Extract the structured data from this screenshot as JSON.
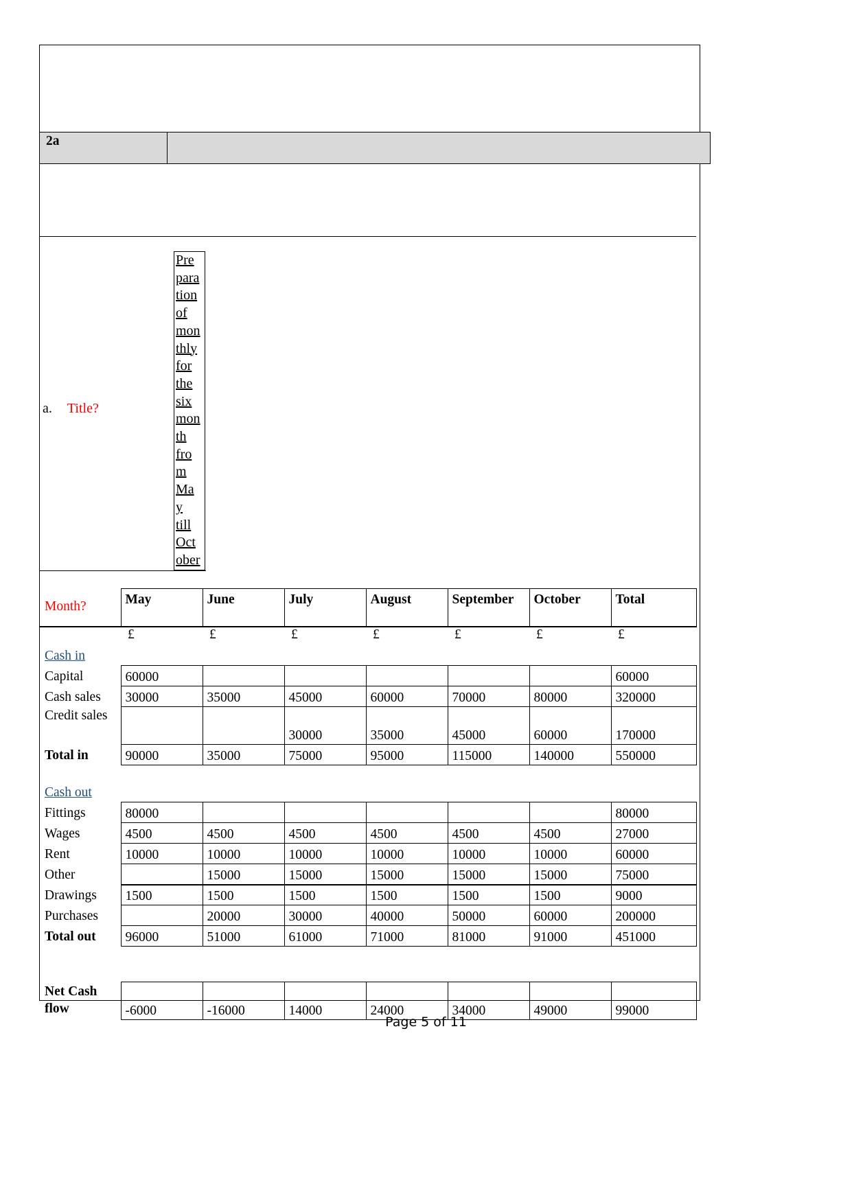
{
  "document": {
    "section_label": "2a",
    "section_label_right": "",
    "question": {
      "marker": "a.",
      "text": "Title?"
    },
    "narrow_column_fragments": [
      "Pre",
      "para",
      "tion",
      "of",
      "mon",
      "thly",
      "for",
      "the",
      "six",
      "mon",
      "th",
      "fro",
      "m",
      "Ma",
      "y",
      "till",
      "Oct",
      "ober"
    ],
    "narrow_column_full_text": "Preparation of monthly for the six month from May till October"
  },
  "table": {
    "row_label_header": "Month?",
    "columns": [
      "May",
      "June",
      "July",
      "August",
      "September",
      "October",
      "Total"
    ],
    "currency_symbol": "£",
    "sections": [
      {
        "heading": "Cash in",
        "rows": [
          {
            "label": "Capital",
            "values": [
              "60000",
              "",
              "",
              "",
              "",
              "",
              "60000"
            ],
            "bold": false,
            "tall": false
          },
          {
            "label": "Cash sales",
            "values": [
              "30000",
              "35000",
              "45000",
              "60000",
              "70000",
              "80000",
              "320000"
            ],
            "bold": false,
            "tall": false
          },
          {
            "label": "Credit sales",
            "values": [
              "",
              "",
              "30000",
              "35000",
              "45000",
              "60000",
              "170000"
            ],
            "bold": false,
            "tall": true
          },
          {
            "label": "Total in",
            "values": [
              "90000",
              "35000",
              "75000",
              "95000",
              "115000",
              "140000",
              "550000"
            ],
            "bold": true,
            "tall": false
          }
        ]
      },
      {
        "heading": "Cash out",
        "rows": [
          {
            "label": "Fittings",
            "values": [
              "80000",
              "",
              "",
              "",
              "",
              "",
              "80000"
            ],
            "bold": false,
            "tall": false
          },
          {
            "label": "Wages",
            "values": [
              "4500",
              "4500",
              "4500",
              "4500",
              "4500",
              "4500",
              "27000"
            ],
            "bold": false,
            "tall": false
          },
          {
            "label": "Rent",
            "values": [
              "10000",
              "10000",
              "10000",
              "10000",
              "10000",
              "10000",
              "60000"
            ],
            "bold": false,
            "tall": false
          },
          {
            "label": "Other",
            "values": [
              "",
              "15000",
              "15000",
              "15000",
              "15000",
              "15000",
              "75000"
            ],
            "bold": false,
            "tall": false
          },
          {
            "label": "Drawings",
            "values": [
              "1500",
              "1500",
              "1500",
              "1500",
              "1500",
              "1500",
              "9000"
            ],
            "bold": false,
            "tall": false
          },
          {
            "label": "Purchases",
            "values": [
              "",
              "20000",
              "30000",
              "40000",
              "50000",
              "60000",
              "200000"
            ],
            "bold": false,
            "tall": false
          },
          {
            "label": "Total out",
            "values": [
              "96000",
              "51000",
              "61000",
              "71000",
              "81000",
              "91000",
              "451000"
            ],
            "bold": true,
            "tall": false
          }
        ]
      }
    ],
    "net_row": {
      "label_line1": "Net   Cash",
      "label_line2": "flow",
      "values": [
        "-6000",
        "-16000",
        "14000",
        "24000",
        "34000",
        "49000",
        "99000"
      ]
    }
  },
  "footer": {
    "page_text": "Page 5 of 11"
  },
  "colors": {
    "question_red": "#ff0000",
    "section_blue": "#1f4e79",
    "header_gray": "#d9d9d9"
  }
}
